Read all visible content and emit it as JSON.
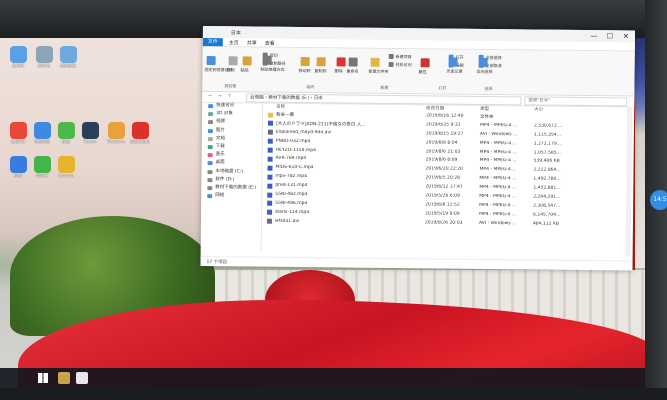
{
  "window": {
    "title": "日本",
    "menu": [
      "文件",
      "主页",
      "共享",
      "查看"
    ],
    "controls": [
      "—",
      "☐",
      "✕"
    ],
    "breadcrumb": "此电脑 › 教材下载的数据 (E:) › 日本",
    "search_placeholder": "搜索\"日本\"",
    "status": "17 个项目"
  },
  "ribbon": {
    "buttons": [
      "固定到快速访问",
      "复制",
      "粘贴",
      "剪切",
      "复制路径",
      "粘贴快捷方式",
      "移动到",
      "复制到",
      "删除",
      "重命名",
      "新建文件夹",
      "新建项目",
      "轻松访问",
      "属性",
      "打开",
      "编辑",
      "历史记录",
      "全部选择",
      "全部取消",
      "反向选择"
    ],
    "groups": [
      "剪贴板",
      "组织",
      "新建",
      "打开",
      "选择"
    ]
  },
  "nav": [
    "快速访问",
    "3D 对象",
    "视频",
    "图片",
    "文档",
    "下载",
    "音乐",
    "桌面",
    "本地磁盘 (C:)",
    "软件 (D:)",
    "教材下载的数据 (E:)",
    "网络"
  ],
  "columns": [
    "名称",
    "修改日期",
    "类型",
    "大小"
  ],
  "files": [
    {
      "name": "粉末一番",
      "date": "2019/8/16 12:40",
      "type": "文件夹",
      "size": ""
    },
    {
      "name": "[大人のドラマ]ADN-211)不倫女の告白 人...",
      "date": "2019/6/25 9:31",
      "type": "MP4 - MPEG-4 ...",
      "size": "2,530,672 ..."
    },
    {
      "name": "Explained_mdyd-944.avi",
      "date": "2019/8/15 19:27",
      "type": "AVI - Windows ...",
      "size": "1,115,354..."
    },
    {
      "name": "PNBO-032.mp4",
      "date": "2019/8/8 8:04",
      "type": "MP4 - MPEG-4 ...",
      "size": "1,272,179..."
    },
    {
      "name": "HEYZO-1159.mp4",
      "date": "2019/8/6 21:03",
      "type": "MP4 - MPEG-4 ...",
      "size": "1,057,585..."
    },
    {
      "name": "AVR-784.mp4",
      "date": "2019/8/6 8:09",
      "type": "MP4 - MPEG-4 ...",
      "size": "539,406 KB"
    },
    {
      "name": "MIDE-610-C.mp4",
      "date": "2019/6/20 22:20",
      "type": "MP4 - MPEG-4 ...",
      "size": "2,222,864..."
    },
    {
      "name": "mpv-782.mp4",
      "date": "2019/6/5 20:28",
      "type": "MP4 - MPEG-4 ...",
      "size": "1,492,780..."
    },
    {
      "name": "pred-131.mp4",
      "date": "2019/6/12 17:47",
      "type": "MP4 - MPEG-4 ...",
      "size": "1,452,881..."
    },
    {
      "name": "SSNI-482.mp4",
      "date": "2019/5/26 6:09",
      "type": "MP4 - MPEG-4 ...",
      "size": "2,264,291..."
    },
    {
      "name": "SSNI-496.mp4",
      "date": "2019/6/8 11:52",
      "type": "MP4 - MPEG-4 ...",
      "size": "2,308,547..."
    },
    {
      "name": "starsi-114.mp4",
      "date": "2019/5/19 9:09",
      "type": "MP4 - MPEG-4 ...",
      "size": "6,145,704..."
    },
    {
      "name": "wfs031.avi",
      "date": "2019/8/26 20:03",
      "type": "AVI - Windows ...",
      "size": "484,112 KB"
    }
  ],
  "desktop_icons": [
    {
      "label": "此电脑",
      "color": "#5aa0e6"
    },
    {
      "label": "回收站",
      "color": "#8aa4b8"
    },
    {
      "label": "控制面板",
      "color": "#6fa8dc"
    },
    {
      "label": "腾讯QQ",
      "color": "#e8473a"
    },
    {
      "label": "百度网盘",
      "color": "#3d8ae0"
    },
    {
      "label": "微信",
      "color": "#4fb84a"
    },
    {
      "label": "Steam",
      "color": "#2a3f5a"
    },
    {
      "label": "WeGame",
      "color": "#e9a23b"
    },
    {
      "label": "网易云音乐",
      "color": "#d9322b"
    },
    {
      "label": "迅雷",
      "color": "#3a7be0"
    },
    {
      "label": "爱奇艺",
      "color": "#43b649"
    },
    {
      "label": "Chrome",
      "color": "#e5b32c"
    }
  ],
  "taskbar_time": "14:5"
}
